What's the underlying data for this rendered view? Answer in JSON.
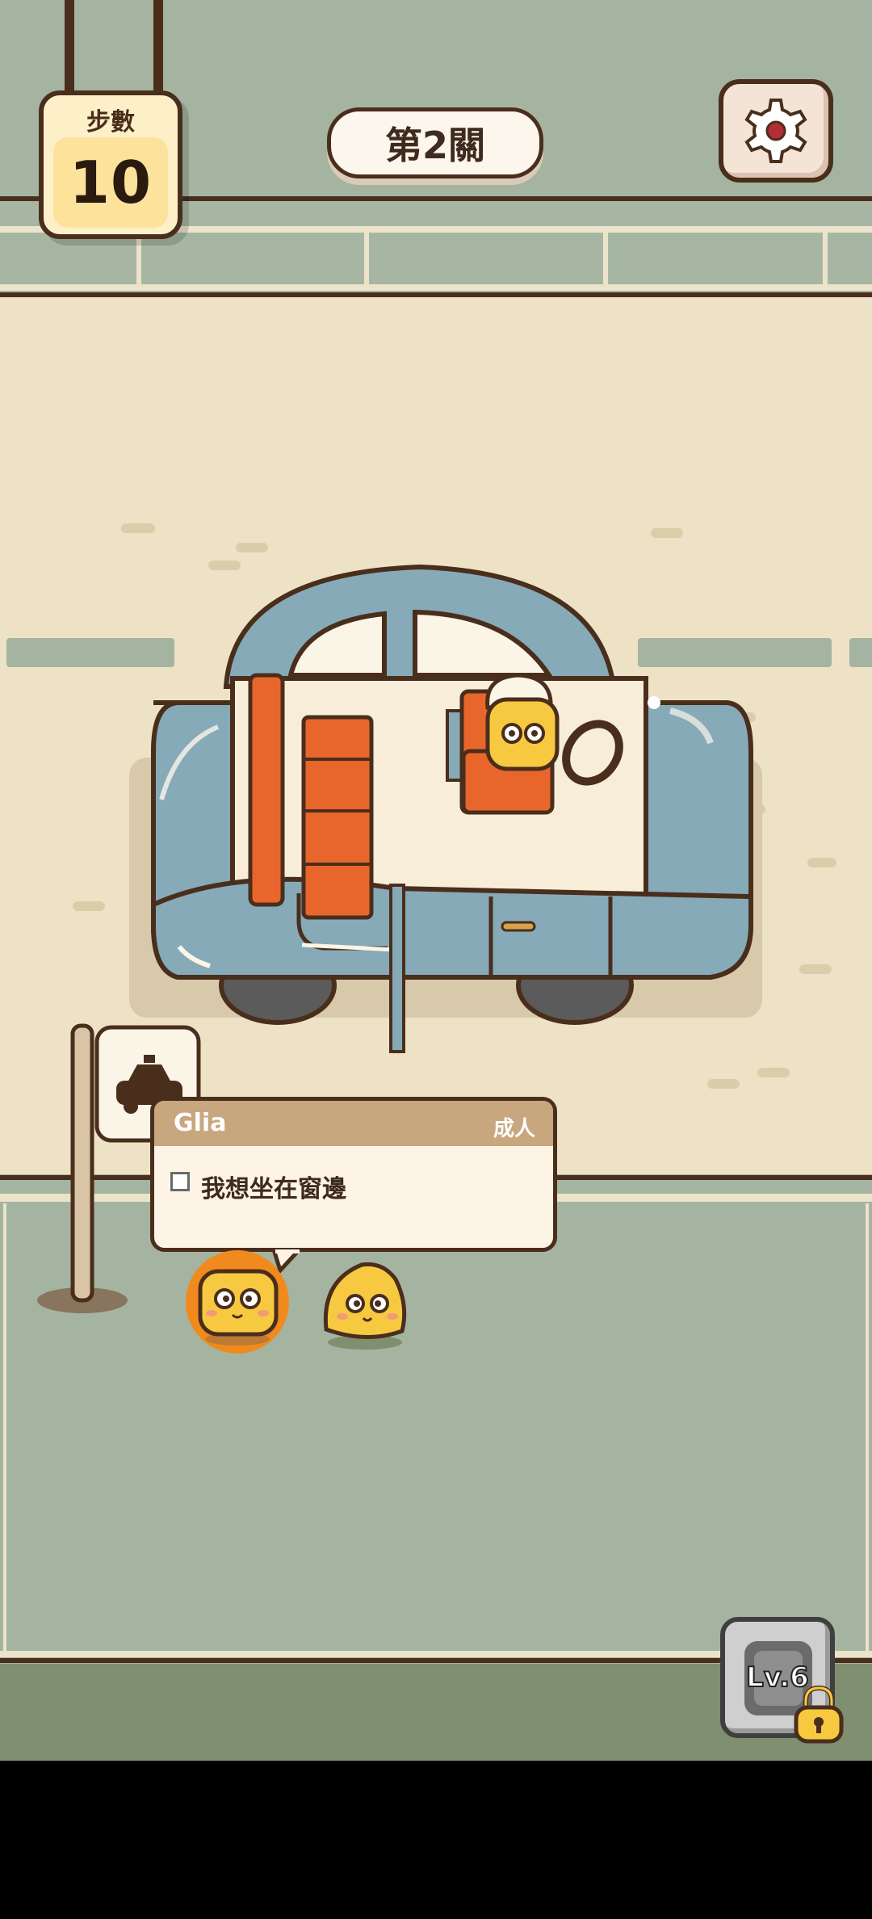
{
  "hud": {
    "steps_label": "步數",
    "steps_value": "10",
    "level_label": "第2關",
    "settings_icon": "gear-icon"
  },
  "passenger_card": {
    "name": "Glia",
    "type": "成人",
    "wish": "我想坐在窗邊",
    "wish_checked": false
  },
  "bottom_button": {
    "level_text": "Lv.6",
    "icon": "lock-icon"
  },
  "colors": {
    "grass": "#a5b4a0",
    "road": "#ede2c6",
    "car_body": "#87aab8",
    "seat": "#e8662b",
    "outline": "#4a2e1c",
    "character": "#f7c940",
    "selected_glow": "#f08a1e"
  }
}
